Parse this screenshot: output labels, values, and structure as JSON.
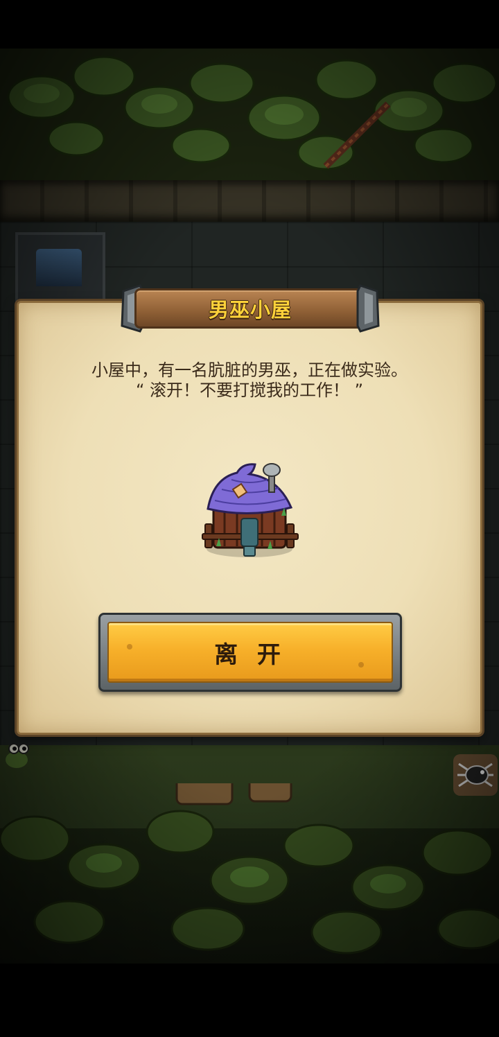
{
  "dialog": {
    "title": "男巫小屋",
    "description_lines": [
      "小屋中，有一名肮脏的男巫，正在做实验。",
      "“ 滚开！不要打搅我的工作！ ”"
    ],
    "image_icon": "wizard-hut-icon",
    "leave_button_label": "离 开"
  },
  "colors": {
    "panel_parchment": "#eedfb6",
    "title_text": "#ffd23a",
    "button_gold": "#f7b02a",
    "body_text": "#3a2a1a"
  }
}
